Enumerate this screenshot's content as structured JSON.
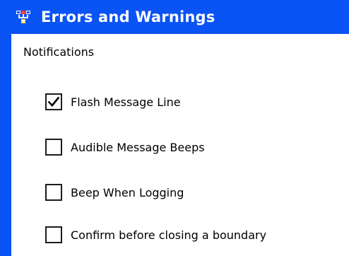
{
  "colors": {
    "title_bar_bg": "#0a53f5",
    "title_text": "#ffffff",
    "content_bg": "#ffffff"
  },
  "header": {
    "icon": "network-settings-icon",
    "title": "Errors and Warnings"
  },
  "section": {
    "label": "Notifications"
  },
  "options": [
    {
      "label": "Flash Message Line",
      "checked": true
    },
    {
      "label": "Audible Message Beeps",
      "checked": false
    },
    {
      "label": "Beep When Logging",
      "checked": false
    },
    {
      "label": "Confirm before closing a boundary",
      "checked": false
    }
  ]
}
